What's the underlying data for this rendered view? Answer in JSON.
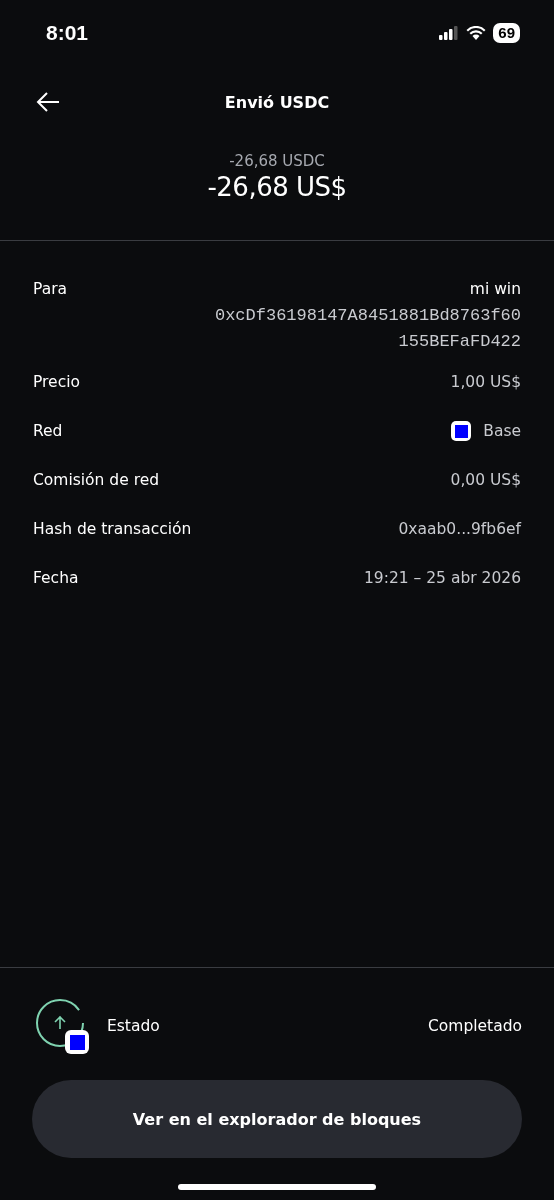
{
  "status_bar": {
    "time": "8:01",
    "battery": "69"
  },
  "header": {
    "title": "Envió USDC"
  },
  "amount": {
    "crypto": "-26,68 USDC",
    "fiat": "-26,68 US$"
  },
  "details": [
    {
      "kind": "address",
      "label": "Para",
      "name": "mi win",
      "address": "0xcDf36198147A8451881Bd8763f60155BEFaFD422"
    },
    {
      "kind": "text",
      "label": "Precio",
      "value": "1,00 US$"
    },
    {
      "kind": "network",
      "label": "Red",
      "value": "Base",
      "color": "#0000ff"
    },
    {
      "kind": "text",
      "label": "Comisión de red",
      "value": "0,00 US$"
    },
    {
      "kind": "text",
      "label": "Hash de transacción",
      "value": "0xaab0...9fb6ef"
    },
    {
      "kind": "text",
      "label": "Fecha",
      "value": "19:21 – 25 abr 2026"
    }
  ],
  "status": {
    "label": "Estado",
    "value": "Completado",
    "color": "#0000ff"
  },
  "button": {
    "label": "Ver en el explorador de bloques"
  }
}
